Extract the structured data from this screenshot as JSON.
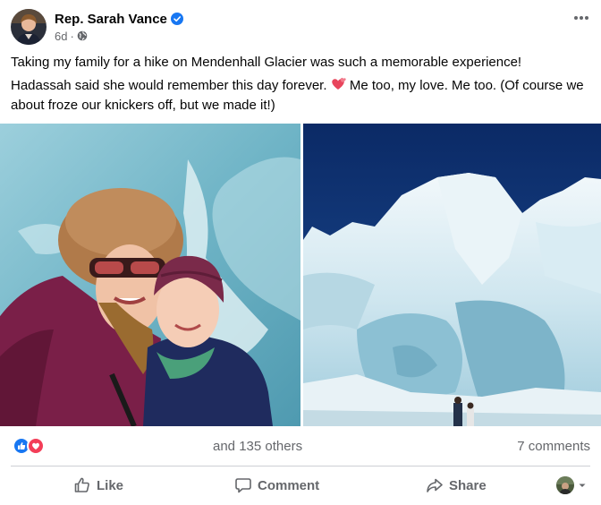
{
  "post": {
    "author": "Rep. Sarah Vance",
    "time": "6d",
    "separator": "·",
    "paragraphs": [
      "Taking my family for a hike on Mendenhall Glacier was such a memorable experience!",
      "Hadassah said she would remember this day forever.",
      " Me too, my love.  Me too. (Of course we about froze our knickers off, but we made it!)"
    ]
  },
  "reactions": {
    "others": "and 135 others",
    "comments": "7 comments"
  },
  "actions": {
    "like": "Like",
    "comment": "Comment",
    "share": "Share"
  },
  "colors": {
    "verified": "#1877f2",
    "like": "#1877f2",
    "love": "#f33e58",
    "text": "#050505",
    "muted": "#65676b"
  }
}
